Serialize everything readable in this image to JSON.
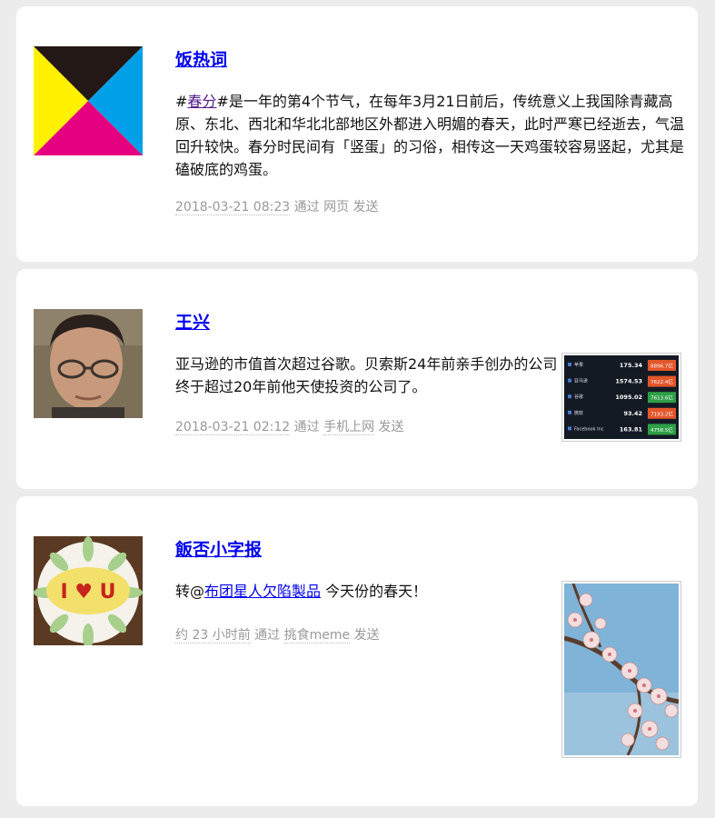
{
  "posts": [
    {
      "author": "饭热词",
      "text_before": "#",
      "hashtag": "春分",
      "text_after": "#是一年的第4个节气，在每年3月21日前后，传统意义上我国除青藏高原、东北、西北和华北北部地区外都进入明媚的春天，此时严寒已经逝去，气温回升较快。春分时民间有「竖蛋」的习俗，相传这一天鸡蛋较容易竖起，尤其是磕破底的鸡蛋。",
      "time": "2018-03-21 08:23",
      "via_label": "通过",
      "source": "网页",
      "sent_label": "发送",
      "avatar_icon": "cmyk-logo-icon",
      "colors": {
        "black": "#231816",
        "cyan": "#00a0e9",
        "magenta": "#e4007f",
        "yellow": "#fff100"
      }
    },
    {
      "author": "王兴",
      "text": "亚马逊的市值首次超过谷歌。贝索斯24年前亲手创办的公司终于超过20年前他天使投资的公司了。",
      "time": "2018-03-21 02:12",
      "via_label": "通过",
      "source": "手机上网",
      "sent_label": "发送",
      "avatar_icon": "man-portrait-avatar",
      "stock_table": [
        {
          "name": "苹果",
          "price": "175.34",
          "cap": "8896.7亿",
          "color": "#e3562a"
        },
        {
          "name": "亚马逊",
          "price": "1574.53",
          "cap": "7622.4亿",
          "color": "#e3562a"
        },
        {
          "name": "谷歌",
          "price": "1095.02",
          "cap": "7613.6亿",
          "color": "#2e9f46"
        },
        {
          "name": "微软",
          "price": "93.42",
          "cap": "7193.2亿",
          "color": "#e3562a"
        },
        {
          "name": "Facebook Inc",
          "price": "163.81",
          "cap": "4758.5亿",
          "color": "#2e9f46"
        }
      ]
    },
    {
      "author": "飯否小字报",
      "text_before": "转@",
      "mention": "布团星人欠陷製品",
      "text_after": " 今天份的春天！",
      "time": "约 23 小时前",
      "via_label": "通过",
      "source": "挑食meme",
      "sent_label": "发送",
      "avatar_icon": "omelette-plate-avatar",
      "avatar_text": "I ♥ U",
      "photo_icon": "cherry-blossom-photo"
    }
  ]
}
